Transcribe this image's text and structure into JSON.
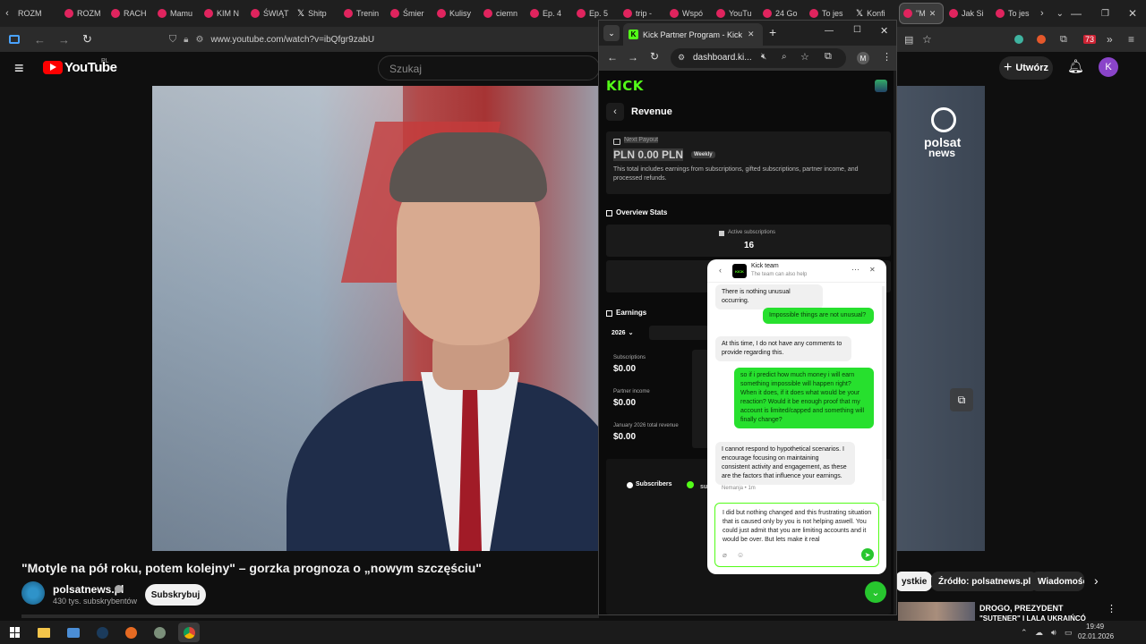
{
  "outer_tabs": [
    {
      "label": "ROZM",
      "type": "plain"
    },
    {
      "label": "ROZM",
      "type": "yt"
    },
    {
      "label": "RACH",
      "type": "yt"
    },
    {
      "label": "Mamu",
      "type": "yt"
    },
    {
      "label": "KIM N",
      "type": "yt"
    },
    {
      "label": "ŚWIĄT",
      "type": "yt"
    },
    {
      "label": "Shitp",
      "type": "x"
    },
    {
      "label": "Trenin",
      "type": "yt"
    },
    {
      "label": "Śmier",
      "type": "yt"
    },
    {
      "label": "Kulisy",
      "type": "yt"
    },
    {
      "label": "ciemn",
      "type": "yt"
    },
    {
      "label": "Ep. 4",
      "type": "yt"
    },
    {
      "label": "Ep. 5",
      "type": "yt"
    },
    {
      "label": "trip -",
      "type": "yt"
    },
    {
      "label": "Wspó",
      "type": "yt"
    },
    {
      "label": "YouTu",
      "type": "yt"
    },
    {
      "label": "24 Go",
      "type": "yt"
    },
    {
      "label": "To jes",
      "type": "yt"
    },
    {
      "label": "Konfi",
      "type": "x"
    },
    {
      "label": "\"M",
      "type": "yt",
      "active": true
    },
    {
      "label": "Jak Si",
      "type": "yt"
    },
    {
      "label": "To jes",
      "type": "yt"
    }
  ],
  "outer_url": "www.youtube.com/watch?v=ibQfgr9zabU",
  "youtube": {
    "logo": "YouTube",
    "region": "PL",
    "search_placeholder": "Szukaj",
    "create_label": "Utwórz",
    "avatar_letter": "K",
    "video_title": "\"Motyle na pół roku, potem kolejny\" – gorzka prognoza o „nowym szczęściu\"",
    "channel_name": "polsatnews.pl",
    "subscribers": "430 tys. subskrybentów",
    "subscribe_label": "Subskrybuj",
    "chips": [
      "ystkie",
      "Źródło: polsatnews.pl",
      "Wiadomości"
    ],
    "rec_title_1": "DROGO, PREZYDENT",
    "rec_title_2": "\"SUTENER\" I LALA UKRAIŃCÓ",
    "watermark_1": "polsat",
    "watermark_2": "news"
  },
  "taskbar": {
    "time": "19:49",
    "date": "02.01.2026"
  },
  "popup": {
    "tab_title": "Kick Partner Program - Kick Da",
    "url": "dashboard.ki...",
    "profile_letter": "M",
    "kick_logo": "KICK",
    "page_title": "Revenue",
    "next_payout_label": "Next Payout",
    "payout_amount": "PLN 0.00 PLN",
    "payout_frequency": "Weekly",
    "payout_note": "This total includes earnings from subscriptions, gifted subscriptions, partner income, and processed refunds.",
    "overview_title": "Overview Stats",
    "active_subs_label": "Active subscriptions",
    "active_subs_value": "16",
    "earnings_title": "Earnings",
    "year": "2026",
    "subs_label": "Subscriptions",
    "subs_value": "$0.00",
    "partner_label": "Partner income",
    "partner_value": "$0.00",
    "total_label": "January 2026 total revenue",
    "total_value": "$0.00",
    "legend_subscribers": "Subscribers",
    "legend_other": "su"
  },
  "chat": {
    "title": "Kick team",
    "subtitle": "The team can also help",
    "messages": [
      {
        "from": "team",
        "text": "There is nothing unusual occurring."
      },
      {
        "from": "user",
        "text": "Impossible things are not unusual?"
      },
      {
        "from": "team",
        "text": "At this time, I do not have any comments to provide regarding this."
      },
      {
        "from": "user",
        "text": "so if i predict how much money i will earn something impossible will happen right? When it does, if it does what would be your reaction? Would it be enough proof that my account is limited/capped and something will finally change?"
      },
      {
        "from": "team",
        "text": "I cannot respond to hypothetical scenarios. I encourage focusing on maintaining consistent activity and engagement, as these are the factors that influence your earnings."
      }
    ],
    "meta": "Nemanja • 1m",
    "draft": "I did but nothing changed and this frustrating situation that is caused only by you is not helping aswell. You could just admit that you are limiting accounts and it would be over. But lets make it real"
  }
}
